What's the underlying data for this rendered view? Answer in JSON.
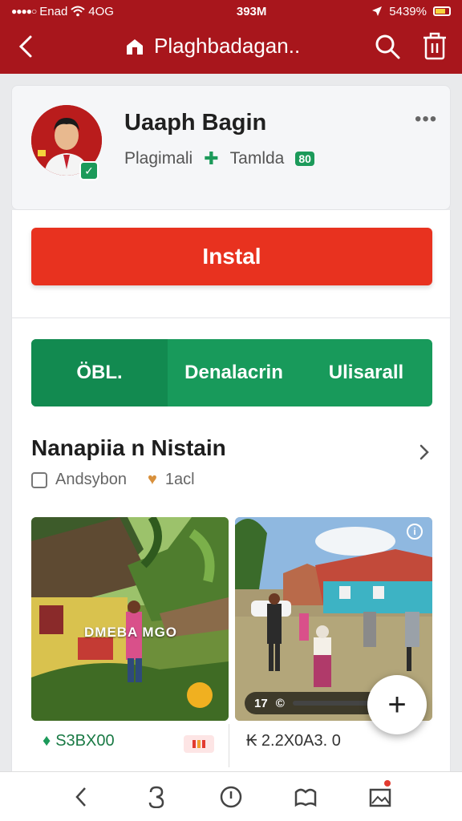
{
  "status_bar": {
    "carrier": "Enad",
    "network": "4OG",
    "time": "393M",
    "battery": "5439%"
  },
  "header": {
    "title": "Plaghbadagan.."
  },
  "profile": {
    "name": "Uaaph Bagin",
    "subtitle_left": "Plagimali",
    "subtitle_right": "Tamlda",
    "badge": "80",
    "verified_mark": "✓"
  },
  "install": {
    "label": "Instal"
  },
  "tabs": [
    {
      "label": "ÖBL.",
      "active": true
    },
    {
      "label": "Denalacrin",
      "active": false
    },
    {
      "label": "Ulisarall",
      "active": false
    }
  ],
  "section": {
    "title": "Nanapiia n Nistain",
    "meta_left": "Andsybon",
    "meta_right": "1acl"
  },
  "cards": [
    {
      "watermark": "DMEBA MGO",
      "price": "S3BX00"
    },
    {
      "ctrl_a": "17",
      "ctrl_b": "©",
      "info": "i",
      "price": "₭ 2.2X0A3. 0"
    }
  ],
  "fab": {
    "symbol": "+"
  },
  "colors": {
    "brand_red": "#a8161c",
    "install_red": "#e8321f",
    "green": "#189a5b"
  }
}
